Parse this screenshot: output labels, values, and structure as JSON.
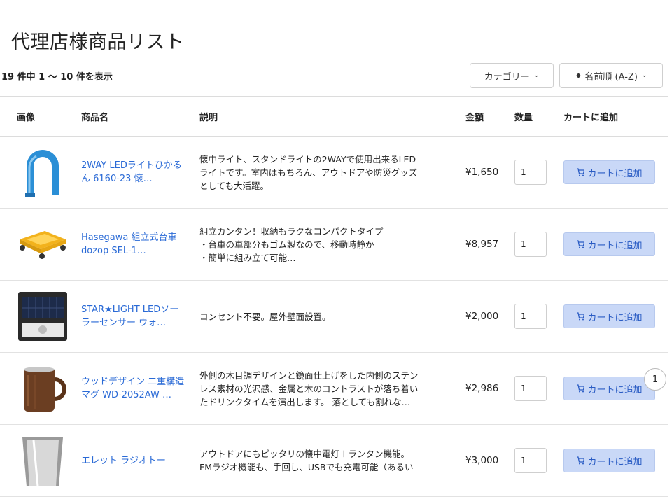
{
  "page": {
    "title": "代理店様商品リスト",
    "result_count": "19 件中 1 ～ 10 件を表示"
  },
  "filters": {
    "category_label": "カテゴリー",
    "sort_label": "名前順 (A-Z)"
  },
  "table": {
    "headers": [
      "画像",
      "商品名",
      "説明",
      "金額",
      "数量",
      "カートに追加"
    ],
    "rows": [
      {
        "image_icon": "led-light-icon",
        "name": "2WAY LEDライトひかるん 6160-23 懐…",
        "description": "懐中ライト、スタンドライトの2WAYで使用出来るLED\nライトです。室内はもちろん、アウトドアや防災グッズ\nとしても大活躍。",
        "price": "¥1,650",
        "quantity": "1",
        "cart_label": "カートに追加"
      },
      {
        "image_icon": "cart-dolly-icon",
        "name": "Hasegawa 組立式台車dozop SEL-1…",
        "description": "組立カンタン！収納もラクなコンパクトタイプ\n・台車の車部分もゴム製なので、移動時静か\n・簡単に組み立て可能…",
        "price": "¥8,957",
        "quantity": "1",
        "cart_label": "カートに追加"
      },
      {
        "image_icon": "solar-sensor-light-icon",
        "name": "STAR★LIGHT LEDソーラーセンサー ウォ…",
        "description": "コンセント不要。屋外壁面設置。",
        "price": "¥2,000",
        "quantity": "1",
        "cart_label": "カートに追加"
      },
      {
        "image_icon": "wooden-mug-icon",
        "name": "ウッドデザイン 二重構造マグ WD-2052AW …",
        "description": "外側の木目調デザインと鏡面仕上げをした内側のステン\nレス素材の光沢感、金属と木のコントラストが落ち着い\nたドリンクタイムを演出します。 落としても割れな…",
        "price": "¥2,986",
        "quantity": "1",
        "cart_label": "カートに追加"
      },
      {
        "image_icon": "radio-lantern-icon",
        "name": "エレット ラジオトー",
        "description": "アウトドアにもピッタリの懐中電灯＋ランタン機能。\nFMラジオ機能も、手回し、USBでも充電可能（あるい",
        "price": "¥3,000",
        "quantity": "1",
        "cart_label": "カートに追加"
      }
    ]
  },
  "cart_badge": {
    "count": "1"
  },
  "colors": {
    "link": "#2a6ad6",
    "cart_button_bg": "#c9d8f7",
    "cart_button_text": "#2a5cc4"
  }
}
